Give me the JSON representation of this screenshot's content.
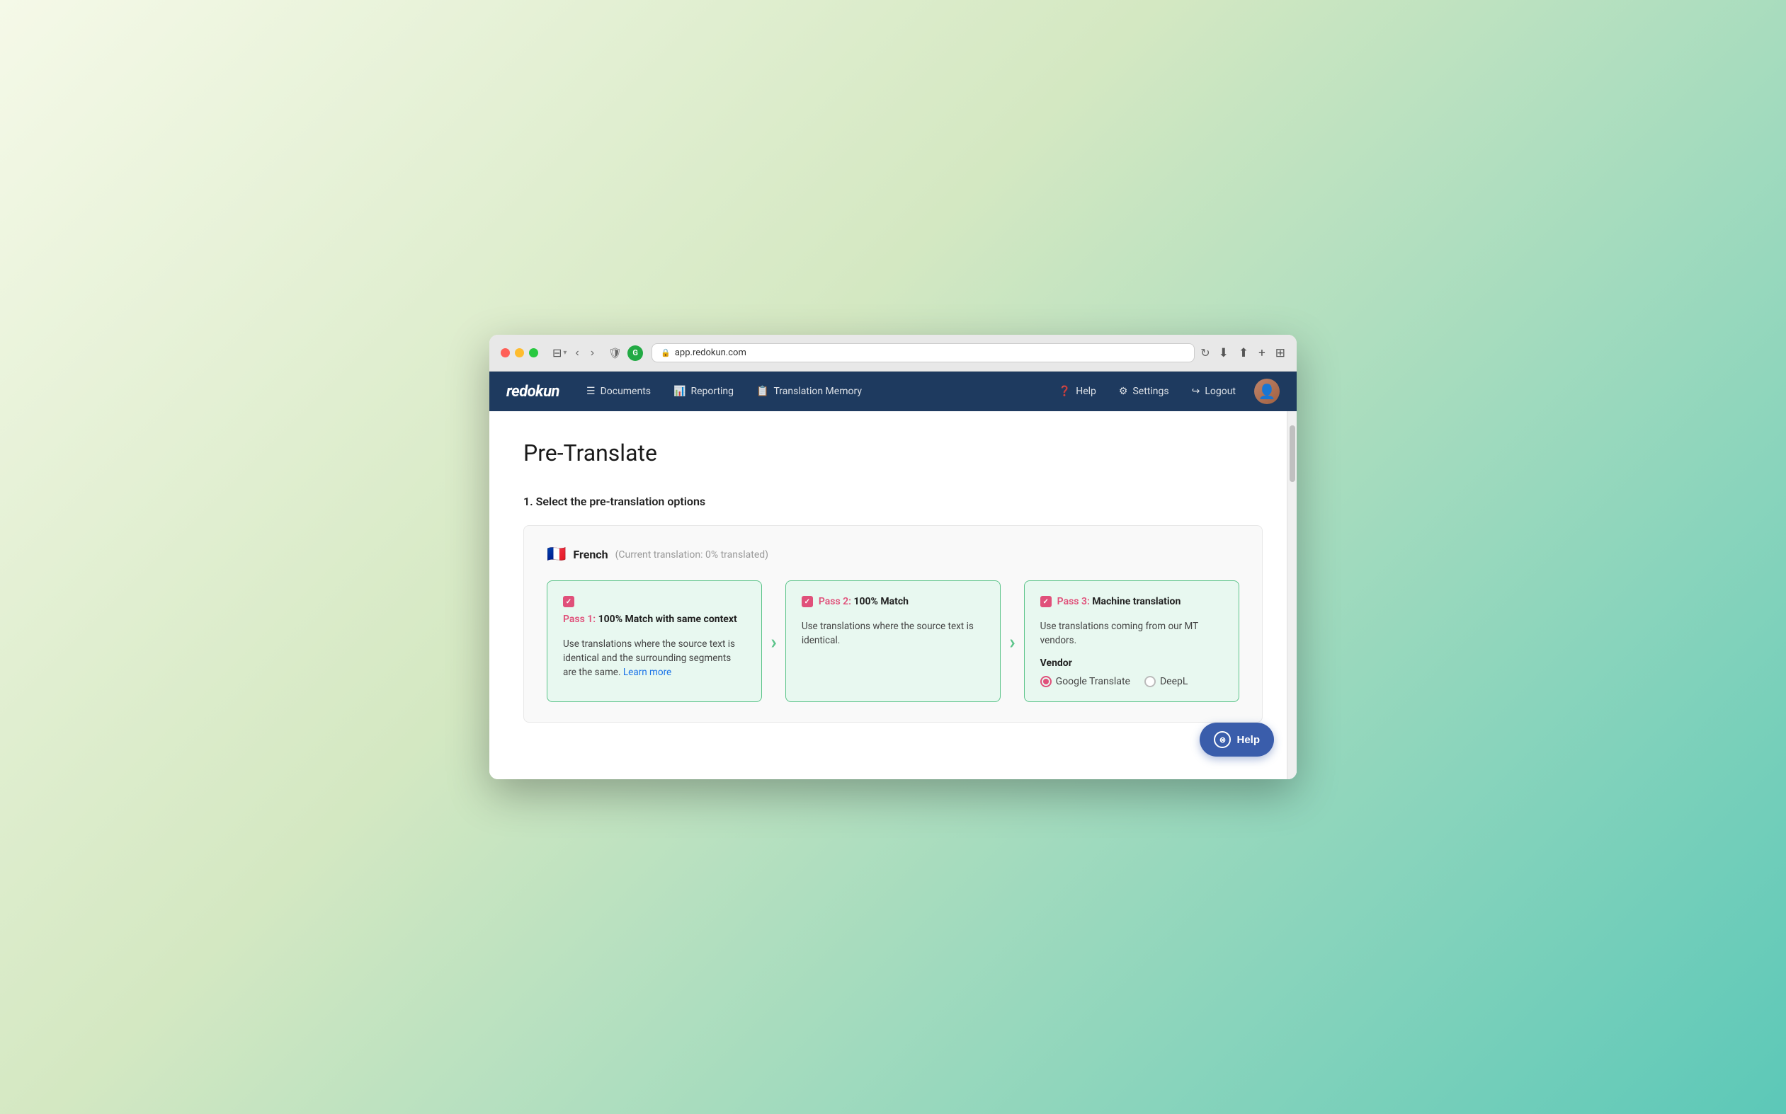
{
  "browser": {
    "address": "app.redokun.com",
    "tab_icon": "🔒"
  },
  "nav": {
    "logo": "redokun",
    "items": [
      {
        "id": "documents",
        "label": "Documents",
        "icon": "☰"
      },
      {
        "id": "reporting",
        "label": "Reporting",
        "icon": "📊"
      },
      {
        "id": "translation-memory",
        "label": "Translation Memory",
        "icon": "📋"
      }
    ],
    "right_items": [
      {
        "id": "help",
        "label": "Help",
        "icon": "❓"
      },
      {
        "id": "settings",
        "label": "Settings",
        "icon": "⚙"
      },
      {
        "id": "logout",
        "label": "Logout",
        "icon": "↪"
      }
    ]
  },
  "page": {
    "title": "Pre-Translate",
    "section_label": "1. Select the pre-translation options",
    "language": {
      "flag": "🇫🇷",
      "name": "French",
      "status": "(Current translation: 0% translated)"
    },
    "passes": [
      {
        "id": "pass1",
        "num_label": "Pass 1:",
        "name": "100% Match with same context",
        "description": "Use translations where the source text is identical and the surrounding segments are the same.",
        "learn_more_text": "Learn more",
        "learn_more_url": "#",
        "checked": true
      },
      {
        "id": "pass2",
        "num_label": "Pass 2:",
        "name": "100% Match",
        "description": "Use translations where the source text is identical.",
        "checked": true
      },
      {
        "id": "pass3",
        "num_label": "Pass 3:",
        "name": "Machine translation",
        "description": "Use translations coming from our MT vendors.",
        "vendor_label": "Vendor",
        "vendors": [
          {
            "id": "google",
            "label": "Google Translate",
            "selected": true
          },
          {
            "id": "deepl",
            "label": "DeepL",
            "selected": false
          }
        ],
        "checked": true
      }
    ],
    "help_button": "Help"
  }
}
